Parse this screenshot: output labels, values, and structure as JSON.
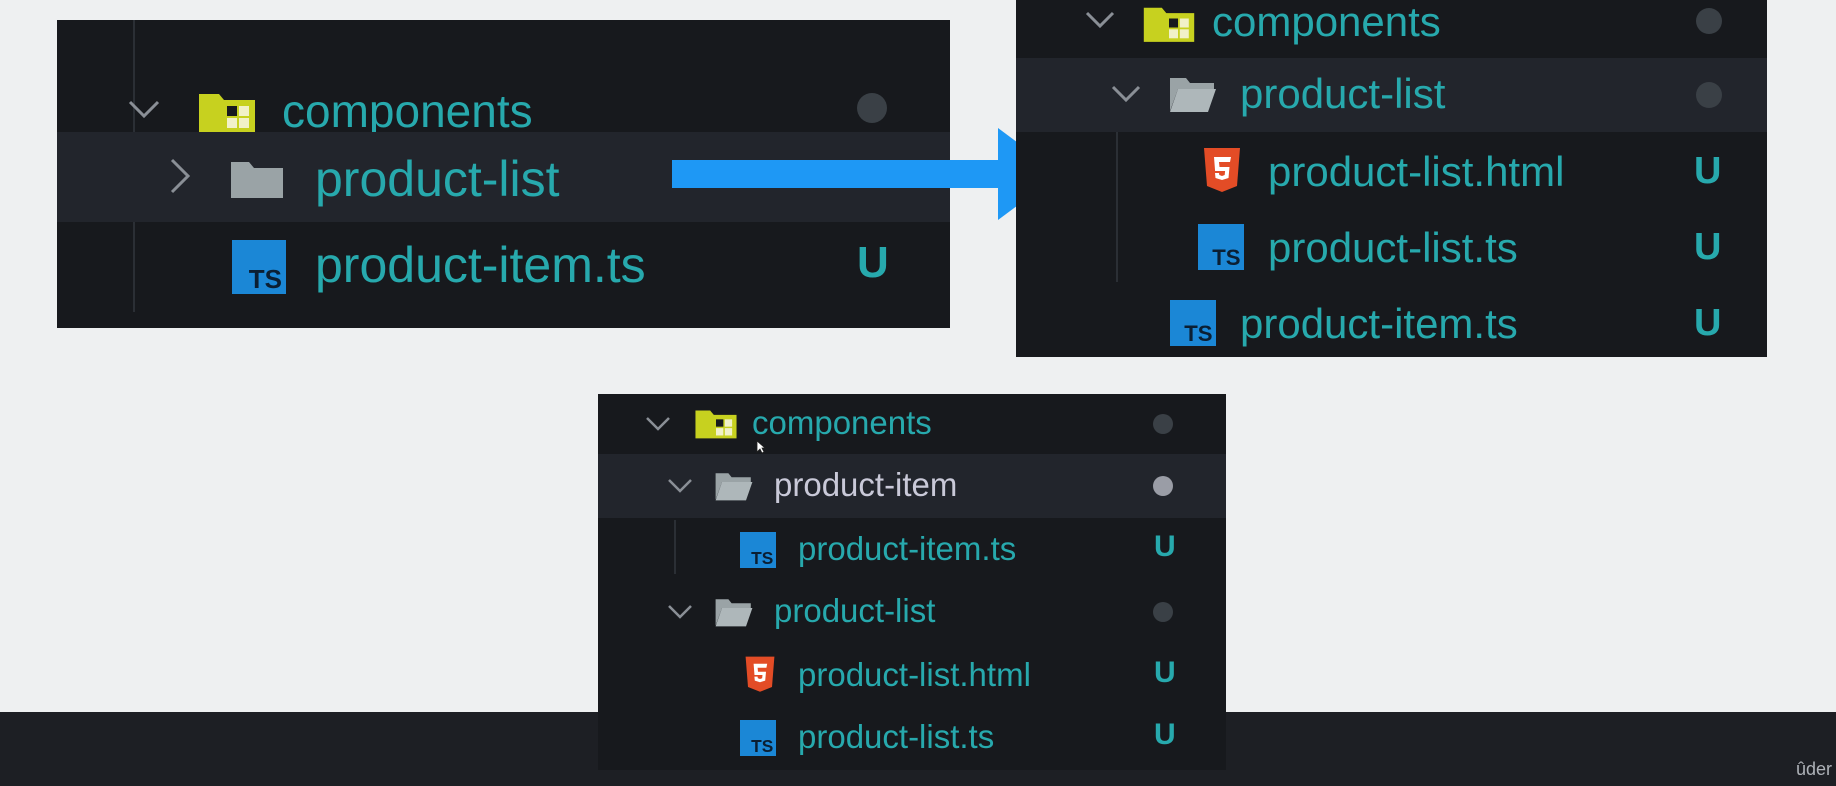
{
  "panel_a": {
    "root": {
      "label": "components",
      "expanded": true
    },
    "items": [
      {
        "label": "product-list",
        "type": "folder",
        "expanded": false
      },
      {
        "label": "product-item.ts",
        "type": "ts",
        "status": "U"
      }
    ]
  },
  "panel_b": {
    "root": {
      "label": "components",
      "expanded": true
    },
    "items": [
      {
        "label": "product-list",
        "type": "folder",
        "expanded": true
      },
      {
        "label": "product-list.html",
        "type": "html",
        "status": "U"
      },
      {
        "label": "product-list.ts",
        "type": "ts",
        "status": "U"
      },
      {
        "label": "product-item.ts",
        "type": "ts",
        "status": "U"
      }
    ]
  },
  "panel_c": {
    "root": {
      "label": "components",
      "expanded": true
    },
    "items": [
      {
        "label": "product-item",
        "type": "folder",
        "expanded": true
      },
      {
        "label": "product-item.ts",
        "type": "ts",
        "status": "U"
      },
      {
        "label": "product-list",
        "type": "folder",
        "expanded": true
      },
      {
        "label": "product-list.html",
        "type": "html",
        "status": "U"
      },
      {
        "label": "product-list.ts",
        "type": "ts",
        "status": "U"
      }
    ]
  },
  "icons": {
    "chevron_down": "chevron-down-icon",
    "chevron_right": "chevron-right-icon",
    "components_folder": "components-folder-icon",
    "folder": "folder-icon",
    "ts_file": "typescript-file-icon",
    "html_file": "html5-file-icon",
    "arrow": "right-arrow"
  },
  "colors": {
    "panel_bg": "#17191d",
    "text_teal": "#27a9ad",
    "text_light": "#c9c9d8",
    "ts_blue": "#1b87d6",
    "html_orange": "#e34c26",
    "arrow_blue": "#1e98f5",
    "components_folder": "#c7d11f"
  },
  "footer": {
    "watermark": "ûder"
  }
}
